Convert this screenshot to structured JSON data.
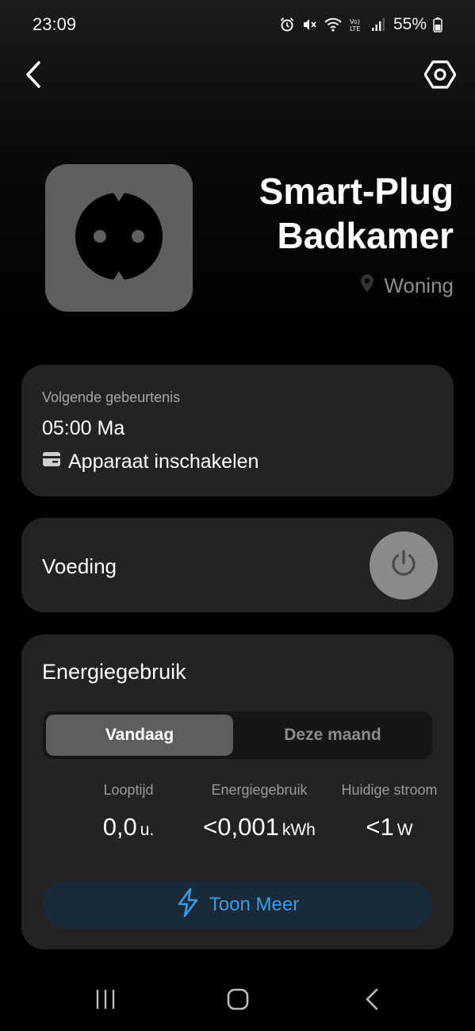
{
  "status_bar": {
    "time": "23:09",
    "battery": "55%",
    "icons": [
      "alarm-icon",
      "mute-icon",
      "wifi-icon",
      "volte-icon",
      "signal-icon",
      "battery-icon"
    ]
  },
  "nav": {
    "back_icon": "chevron-left-icon",
    "settings_icon": "hexagon-settings-icon"
  },
  "device": {
    "name": "Smart-Plug Badkamer",
    "location": "Woning",
    "icon": "power-socket-icon"
  },
  "next_event": {
    "label": "Volgende gebeurtenis",
    "time": "05:00 Ma",
    "action": "Apparaat inschakelen"
  },
  "power": {
    "label": "Voeding",
    "state": "off"
  },
  "energy": {
    "title": "Energiegebruik",
    "tabs": [
      {
        "label": "Vandaag",
        "active": true
      },
      {
        "label": "Deze maand",
        "active": false
      }
    ],
    "stats": [
      {
        "label": "Looptijd",
        "value": "0,0",
        "unit": "u."
      },
      {
        "label": "Energiegebruik",
        "value": "<0,001",
        "unit": "kWh"
      },
      {
        "label": "Huidige stroom",
        "value": "<1",
        "unit": "W"
      }
    ],
    "show_more": "Toon Meer"
  },
  "colors": {
    "accent": "#3a9be8",
    "card": "#232325",
    "tile": "#5f5f5f"
  }
}
